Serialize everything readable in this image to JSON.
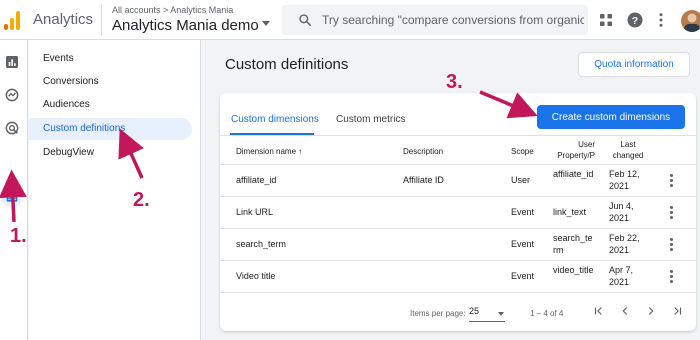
{
  "header": {
    "app_name": "Analytics",
    "breadcrumb": "All accounts > Analytics Mania",
    "property_name": "Analytics Mania demo",
    "search_placeholder": "Try searching \"compare conversions from organic...\""
  },
  "rail": {
    "icons": [
      "reports-icon",
      "explore-icon",
      "advertising-icon",
      "configure-icon"
    ]
  },
  "sidenav": {
    "items": [
      {
        "label": "Events"
      },
      {
        "label": "Conversions"
      },
      {
        "label": "Audiences"
      },
      {
        "label": "Custom definitions",
        "active": true
      },
      {
        "label": "DebugView"
      }
    ]
  },
  "main": {
    "title": "Custom definitions",
    "quota_button": "Quota information",
    "create_button": "Create custom dimensions",
    "tabs": [
      {
        "label": "Custom dimensions",
        "active": true
      },
      {
        "label": "Custom metrics"
      }
    ],
    "columns": {
      "name": "Dimension name",
      "description": "Description",
      "scope": "Scope",
      "property": "User Property/P",
      "last_changed": "Last changed"
    },
    "rows": [
      {
        "name": "affiliate_id",
        "description": "Affiliate ID",
        "scope": "User",
        "param": "affiliate_id",
        "changed": "Feb 12, 2021"
      },
      {
        "name": "Link URL",
        "description": "",
        "scope": "Event",
        "param": "link_text",
        "changed": "Jun 4, 2021"
      },
      {
        "name": "search_term",
        "description": "",
        "scope": "Event",
        "param": "search_term",
        "changed": "Feb 22, 2021"
      },
      {
        "name": "Video title",
        "description": "",
        "scope": "Event",
        "param": "video_title",
        "changed": "Apr 7, 2021"
      }
    ],
    "footer": {
      "items_per_page_label": "Items per page:",
      "items_per_page_value": "25",
      "range": "1 – 4 of 4"
    }
  },
  "annotations": [
    "1.",
    "2.",
    "3."
  ],
  "colors": {
    "accent": "#1a73e8",
    "annotation": "#c2185b",
    "active_nav_bg": "#e8f0fe"
  }
}
